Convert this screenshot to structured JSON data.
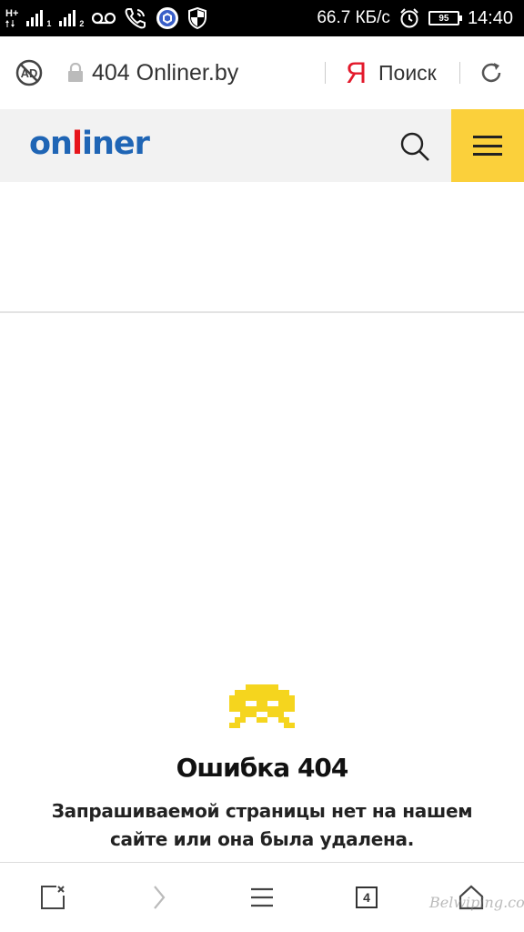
{
  "status_bar": {
    "network_1": "H+",
    "sim_1": "1",
    "sim_2": "2",
    "speed": "66.7 КБ/с",
    "battery_level": "95",
    "time": "14:40",
    "icons": [
      "signal-icon",
      "signal-icon",
      "voicemail-icon",
      "wifi-call-icon",
      "app-icon",
      "shield-icon",
      "alarm-icon",
      "battery-icon"
    ]
  },
  "address_bar": {
    "url": "404 Onliner.by",
    "search_engine_logo": "Я",
    "search_label": "Поиск",
    "icons": [
      "adblock-icon",
      "lock-icon",
      "reload-icon"
    ]
  },
  "site_header": {
    "logo_prefix": "on",
    "logo_accent": "l",
    "logo_suffix": "iner",
    "brand_color": "#1f65b5",
    "accent_color": "#e7141a",
    "menu_color": "#fbd03b",
    "icons": [
      "search-icon",
      "hamburger-menu-icon"
    ]
  },
  "error": {
    "title": "Ошибка 404",
    "message": "Запрашиваемой страницы нет на нашем сайте или она была удалена.",
    "icon": "space-invader-icon",
    "icon_color": "#f5d51e"
  },
  "bottom_toolbar": {
    "tab_count": "4",
    "icons": [
      "close-tabs-icon",
      "forward-icon",
      "menu-icon",
      "tabs-icon",
      "home-icon"
    ]
  },
  "watermark": "Belwiping.com"
}
